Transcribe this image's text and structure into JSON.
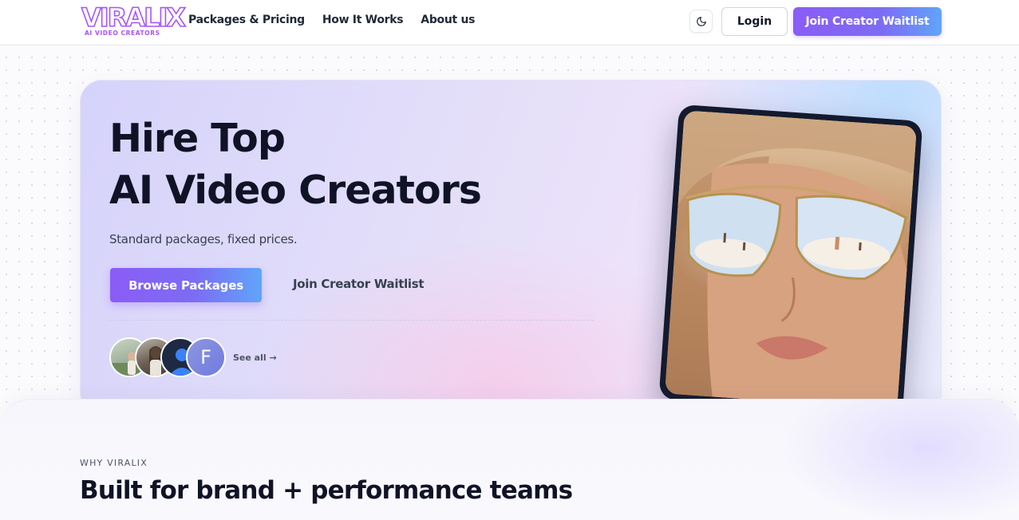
{
  "brand": {
    "logo_text": "VIRALIX",
    "logo_tagline": "AI VIDEO CREATORS",
    "accent_purple": "#8b5cf6",
    "accent_blue": "#60a5fa"
  },
  "header": {
    "nav": [
      {
        "label": "Packages & Pricing"
      },
      {
        "label": "How It Works"
      },
      {
        "label": "About us"
      }
    ],
    "theme_toggle_icon": "moon-icon",
    "login_label": "Login",
    "join_label": "Join Creator Waitlist"
  },
  "hero": {
    "title_line1": "Hire Top",
    "title_line2": "AI Video Creators",
    "subtitle": "Standard packages, fixed prices.",
    "primary_cta": "Browse Packages",
    "secondary_cta": "Join Creator Waitlist",
    "avatar_initial": "F",
    "see_all": "See all →",
    "showcase_image": "woman-in-sunglasses-photo"
  },
  "why": {
    "eyebrow": "WHY VIRALIX",
    "title": "Built for brand + performance teams"
  }
}
